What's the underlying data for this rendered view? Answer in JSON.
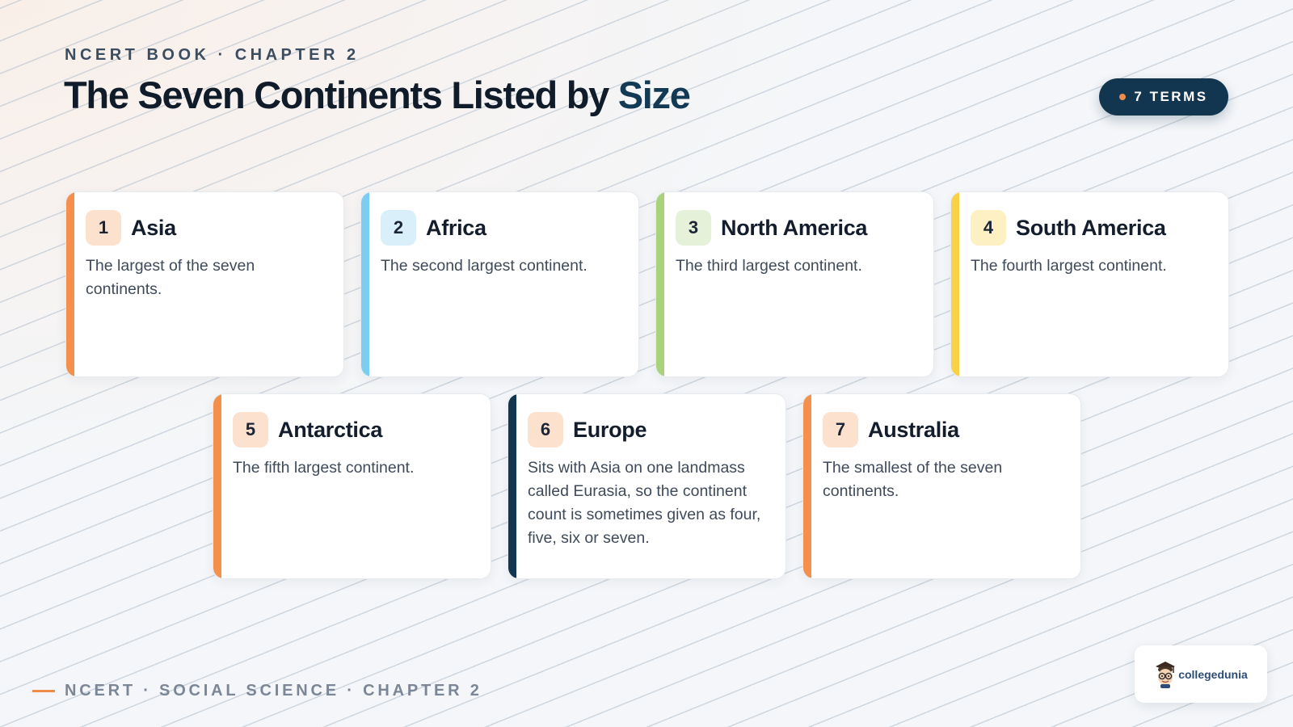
{
  "header": {
    "eyebrow": "NCERT BOOK · CHAPTER 2",
    "title_main": "The Seven Continents Listed by ",
    "title_accent": "Size",
    "badge": "7 TERMS"
  },
  "cards": [
    {
      "num": "1",
      "name": "Asia",
      "desc": "The largest of the seven continents."
    },
    {
      "num": "2",
      "name": "Africa",
      "desc": "The second largest continent."
    },
    {
      "num": "3",
      "name": "North America",
      "desc": "The third largest continent."
    },
    {
      "num": "4",
      "name": "South America",
      "desc": "The fourth largest continent."
    },
    {
      "num": "5",
      "name": "Antarctica",
      "desc": "The fifth largest continent."
    },
    {
      "num": "6",
      "name": "Europe",
      "desc": "Sits with Asia on one landmass called Eurasia, so the continent count is sometimes given as four, five, six or seven."
    },
    {
      "num": "7",
      "name": "Australia",
      "desc": "The smallest of the seven continents."
    }
  ],
  "colors": {
    "orange": "#f58f4c",
    "blue": "#7ccdf2",
    "green": "#a9d27c",
    "yellow": "#f7d146",
    "navy": "#123650",
    "num_bg_orange": "#fde1cf",
    "num_bg_blue": "#d9f0fb",
    "num_bg_green": "#e6f1da",
    "num_bg_yellow": "#fdf1c4"
  },
  "footer": {
    "text": "NCERT · SOCIAL SCIENCE · CHAPTER 2"
  },
  "brand": {
    "wordmark": "collegedunia",
    "icon": "mascot-icon"
  }
}
